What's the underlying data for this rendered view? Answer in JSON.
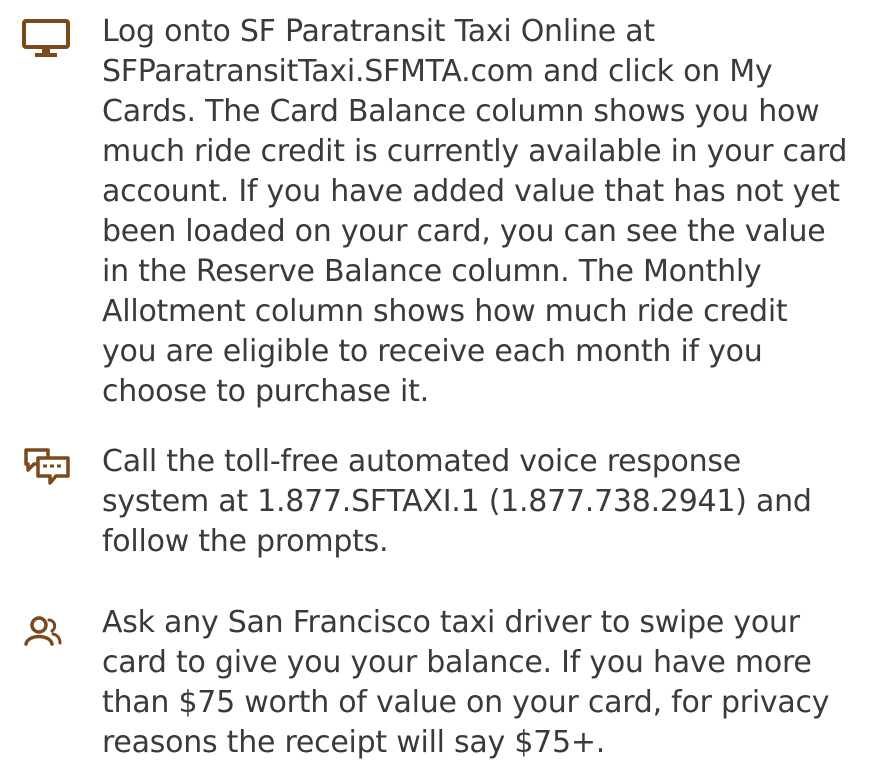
{
  "accent_color": "#7a4a1c",
  "items": [
    {
      "icon": "computer-monitor-icon",
      "lines": [
        "Log onto SF Paratransit Taxi Online at",
        "SFParatransitTaxi.SFMTA.com and click on My",
        "Cards. The Card Balance column shows you how",
        "much ride credit is currently available in your card",
        "account. If you have added value that has not yet",
        "been loaded on your card, you can see the value",
        "in the Reserve Balance column. The Monthly",
        "Allotment column shows how much ride credit",
        "you are eligible to receive each month if you",
        "choose to purchase it."
      ]
    },
    {
      "icon": "speech-bubbles-icon",
      "lines": [
        "Call the toll-free automated voice response",
        "system at 1.877.SFTAXI.1 (1.877.738.2941) and",
        "follow the prompts."
      ]
    },
    {
      "icon": "people-icon",
      "lines": [
        "Ask any San Francisco taxi driver to swipe your",
        "card to give you your balance. If you have more",
        "than $75 worth of value on your card, for privacy",
        "reasons the receipt will say $75+."
      ]
    }
  ]
}
